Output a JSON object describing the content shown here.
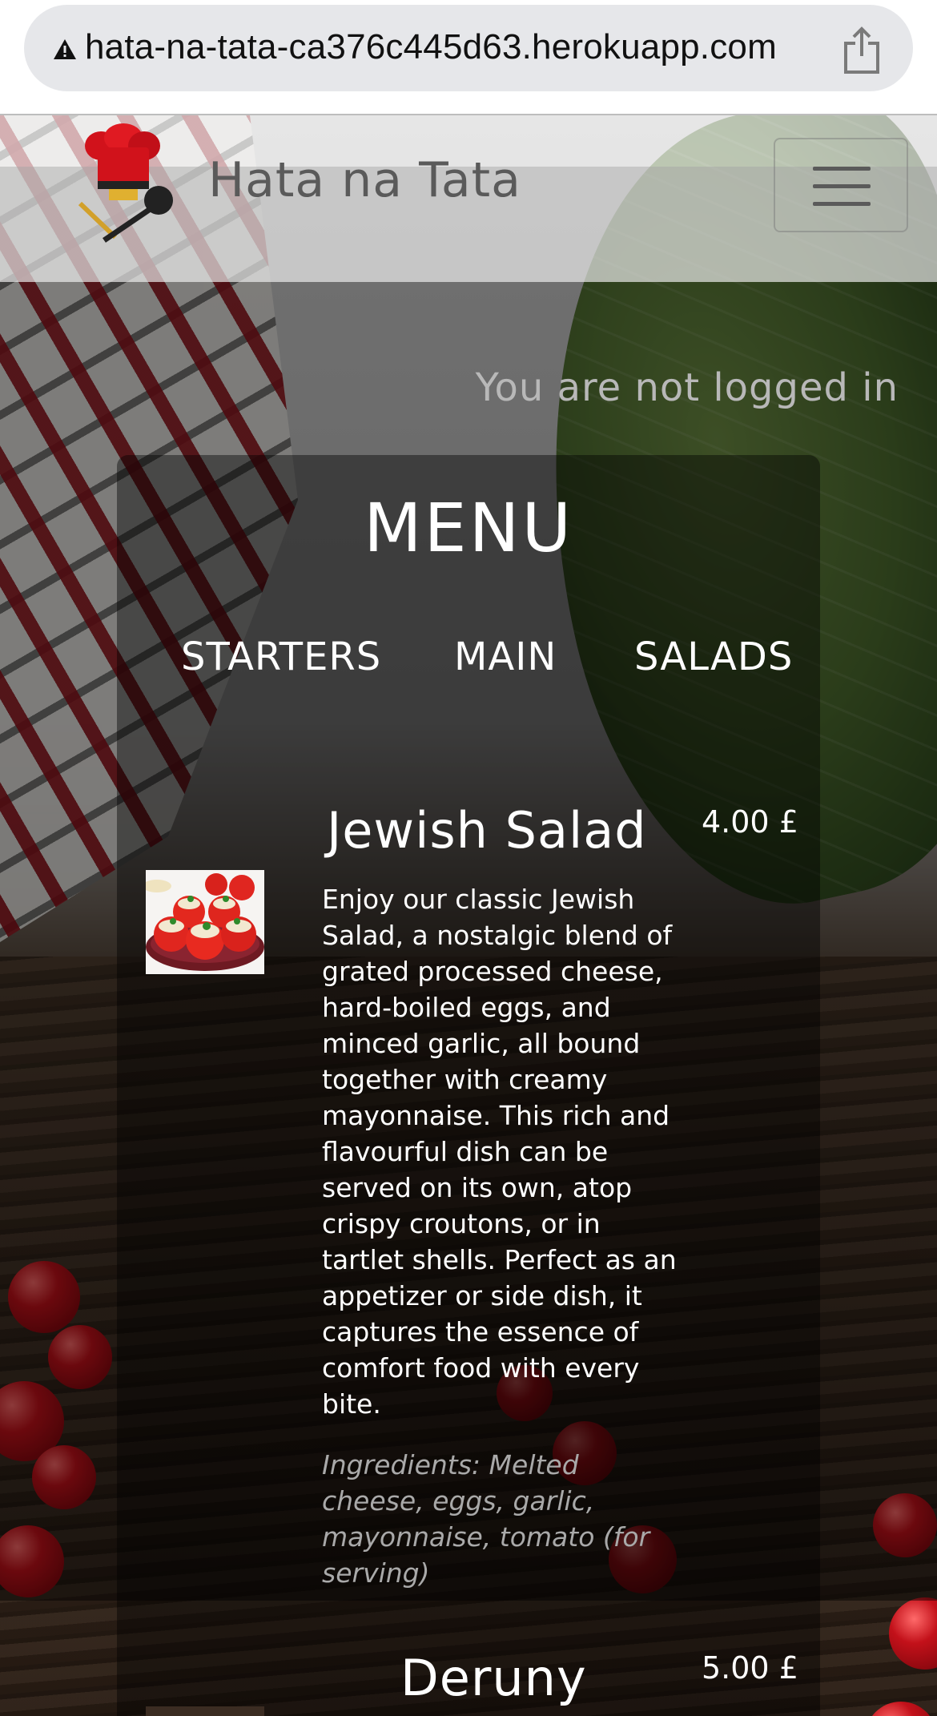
{
  "browser": {
    "url": "hata-na-tata-ca376c445d63.herokuapp.com",
    "warning_icon": "warning-triangle-icon",
    "share_icon": "share-icon"
  },
  "navbar": {
    "brand": "Hata na Tata",
    "logo_icon": "chef-hat-logo-icon",
    "toggle_icon": "hamburger-menu-icon"
  },
  "status": {
    "login_text": "You are not logged in"
  },
  "menu": {
    "title": "MENU",
    "tabs": [
      {
        "label": "STARTERS"
      },
      {
        "label": "MAIN"
      },
      {
        "label": "SALADS"
      }
    ],
    "dishes": [
      {
        "name": "Jewish Salad",
        "price": "4.00 £",
        "description": "Enjoy our classic Jewish Salad, a nostalgic blend of grated processed cheese, hard-boiled eggs, and minced garlic, all bound together with creamy mayonnaise. This rich and flavourful dish can be served on its own, atop crispy croutons, or in tartlet shells. Perfect as an appetizer or side dish, it captures the essence of comfort food with every bite.",
        "ingredients": "Ingredients: Melted cheese, eggs, garlic, mayonnaise, tomato (for serving)"
      },
      {
        "name": "Deruny",
        "price": "5.00 £"
      }
    ]
  },
  "colors": {
    "accent_text": "#ffffff",
    "muted_text": "#a9a9a9",
    "brand_text": "#5a5a5a"
  }
}
